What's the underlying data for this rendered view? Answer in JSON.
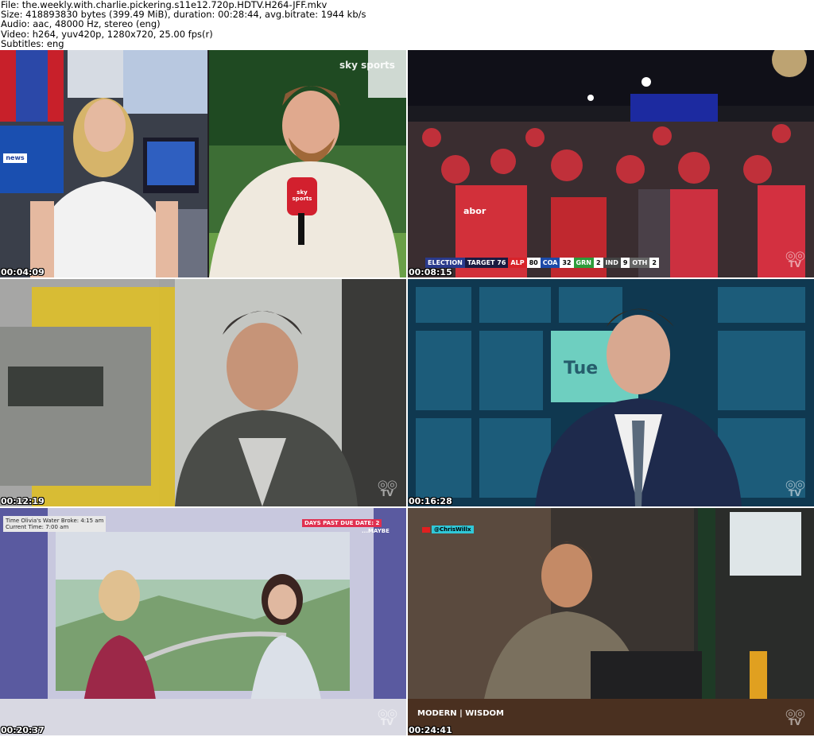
{
  "info": {
    "file": "File: the.weekly.with.charlie.pickering.s11e12.720p.HDTV.H264-JFF.mkv",
    "size": "Size: 418893830 bytes (399.49 MiB), duration: 00:28:44, avg.bitrate: 1944 kb/s",
    "audio": "Audio: aac, 48000 Hz, stereo (eng)",
    "video": "Video: h264, yuv420p, 1280x720, 25.00 fps(r)",
    "subtitles": "Subtitles: eng"
  },
  "thumbs": [
    {
      "timestamp": "00:04:09",
      "overlay": "news"
    },
    {
      "timestamp": "00:08:15",
      "overlay_left": "sky sports",
      "mic_label": "sky sports"
    },
    {
      "timestamp": "00:12:19",
      "watermark": "TV"
    },
    {
      "timestamp": "00:16:28",
      "watermark": "TV",
      "screen_text": "Tue"
    },
    {
      "timestamp": "00:20:37",
      "watermark": "TV",
      "box_line1": "Time Olivia's Water Broke: 4:15 am",
      "box_line2": "Current Time: 7:00 am",
      "days_label": "DAYS PAST DUE DATE: 2",
      "maybe": "...MAYBE"
    },
    {
      "timestamp": "00:24:41",
      "watermark": "TV",
      "handle": "@ChrisWillx",
      "brand": "MODERN | WISDOM"
    }
  ],
  "election": {
    "title": "ELECTION",
    "target": "TARGET 76",
    "parties": [
      {
        "name": "ALP",
        "value": "80",
        "color": "#d8232a"
      },
      {
        "name": "COA",
        "value": "32",
        "color": "#1c4aa8"
      },
      {
        "name": "GRN",
        "value": "2",
        "color": "#2e9b3a"
      },
      {
        "name": "IND",
        "value": "9",
        "color": "#444"
      },
      {
        "name": "OTH",
        "value": "2",
        "color": "#666"
      }
    ],
    "shirt_text": "abor"
  }
}
